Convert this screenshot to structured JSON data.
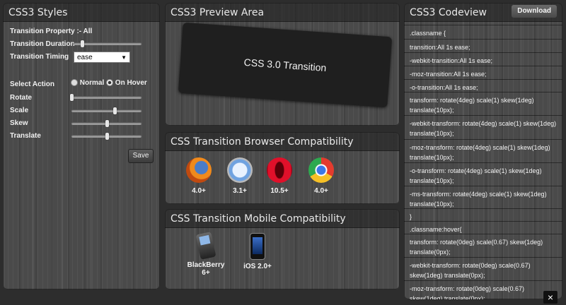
{
  "styles_panel": {
    "title": "CSS3 Styles",
    "transition_property_label": "Transition Property :- All",
    "transition_duration_label": "Transition Duration",
    "transition_duration_value": 0.12,
    "transition_timing_label": "Transition Timing",
    "transition_timing_value": "ease",
    "select_action_label": "Select Action",
    "radio_normal_label": "Normal",
    "radio_hover_label": "On Hover",
    "selected_action": "On Hover",
    "rotate_label": "Rotate",
    "rotate_value": 0.0,
    "scale_label": "Scale",
    "scale_value": 0.62,
    "skew_label": "Skew",
    "skew_value": 0.5,
    "translate_label": "Translate",
    "translate_value": 0.5,
    "save_label": "Save"
  },
  "preview_panel": {
    "title": "CSS3 Preview Area",
    "box_text": "CSS 3.0 Transition"
  },
  "compat_panel": {
    "title": "CSS Transition Browser Compatibility",
    "browsers": [
      {
        "name": "firefox-icon",
        "version": "4.0+"
      },
      {
        "name": "safari-icon",
        "version": "3.1+"
      },
      {
        "name": "opera-icon",
        "version": "10.5+"
      },
      {
        "name": "chrome-icon",
        "version": "4.0+"
      }
    ]
  },
  "mobile_panel": {
    "title": "CSS Transition Mobile Compatibility",
    "devices": [
      {
        "name": "blackberry-icon",
        "label": "BlackBerry 6+"
      },
      {
        "name": "iphone-icon",
        "label": "iOS 2.0+"
      }
    ]
  },
  "code_panel": {
    "title": "CSS3 Codeview",
    "download_label": "Download",
    "lines": [
      ".classname {",
      "transition:All 1s ease;",
      "-webkit-transition:All 1s ease;",
      "-moz-transition:All 1s ease;",
      "-o-transition:All 1s ease;",
      "transform: rotate(4deg) scale(1) skew(1deg) translate(10px);",
      "-webkit-transform: rotate(4deg) scale(1) skew(1deg) translate(10px);",
      "-moz-transform: rotate(4deg) scale(1) skew(1deg) translate(10px);",
      "-o-transform: rotate(4deg) scale(1) skew(1deg) translate(10px);",
      "-ms-transform: rotate(4deg) scale(1) skew(1deg) translate(10px);",
      "}",
      ".classname:hover{",
      "transform: rotate(0deg) scale(0.67) skew(1deg) translate(0px);",
      "-webkit-transform: rotate(0deg) scale(0.67) skew(1deg) translate(0px);",
      "-moz-transform: rotate(0deg) scale(0.67) skew(1deg) translate(0px);"
    ]
  },
  "close_label": "×"
}
